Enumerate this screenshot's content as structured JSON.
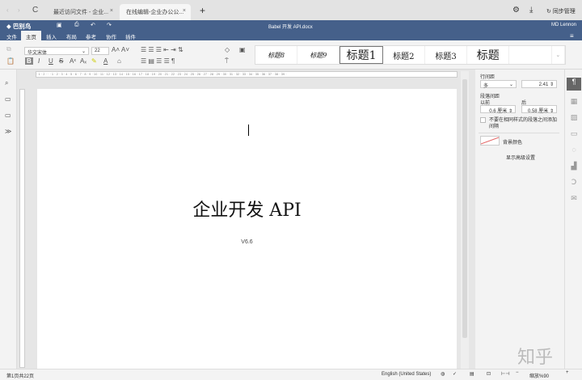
{
  "browser": {
    "tabs": [
      {
        "label": "最近访问文件 - 企业..."
      },
      {
        "label": "在线编辑-企业办公公..."
      }
    ],
    "sync_label": "同步管理"
  },
  "app": {
    "brand": "巴别鸟",
    "doc_title": "Babel 开发 API.docx",
    "user": "MD Lennon"
  },
  "menu": [
    "文件",
    "主页",
    "插入",
    "布局",
    "参考",
    "协作",
    "插件"
  ],
  "toolbar": {
    "font_name": "华文宋体",
    "font_size": "22",
    "styles": [
      "标题8",
      "标题9",
      "标题1",
      "标题2",
      "标题3",
      "标题"
    ]
  },
  "panel": {
    "line_spacing_label": "行间距",
    "line_spacing_mode": "多",
    "line_spacing_value": "2.41",
    "para_spacing_label": "段落间距",
    "before_label": "以前",
    "after_label": "后",
    "before_value": "0.6 厘米",
    "after_value": "0.58 厘米",
    "no_space_label": "不要在相同样式的段落之间添加间隔",
    "bg_color_label": "背景颜色",
    "advanced_label": "显示高级设置"
  },
  "document": {
    "title": "企业开发 API",
    "version": "V6.6"
  },
  "status": {
    "page_info": "第1页共22页",
    "language": "English (United States)",
    "zoom": "缩放%90"
  },
  "watermark": "知乎"
}
